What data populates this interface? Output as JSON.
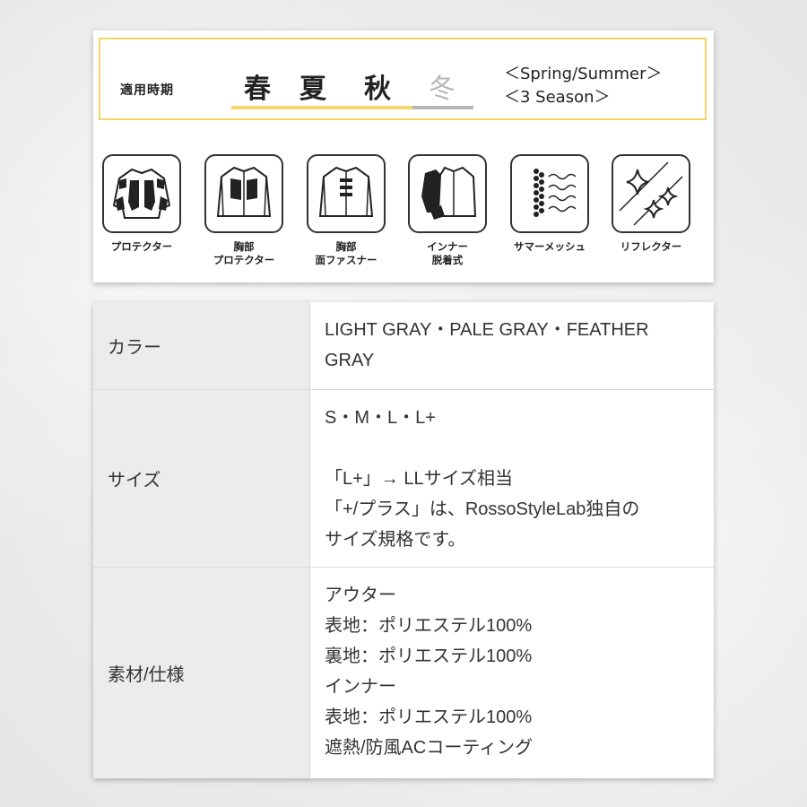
{
  "season": {
    "label": "適用時期",
    "words": [
      "春",
      "夏",
      "秋",
      "冬"
    ],
    "active": [
      true,
      true,
      true,
      false
    ],
    "english_line1": "＜Spring/Summer＞",
    "english_line2": "＜3 Season＞",
    "colors": {
      "active_bar": "#f3d56a",
      "inactive_bar": "#b8b8b8",
      "border": "#f3d56a"
    }
  },
  "features": [
    {
      "icon": "jacket-protector-icon",
      "label_line1": "プロテクター",
      "label_line2": ""
    },
    {
      "icon": "chest-protector-icon",
      "label_line1": "胸部",
      "label_line2": "プロテクター"
    },
    {
      "icon": "chest-fastener-icon",
      "label_line1": "胸部",
      "label_line2": "面ファスナー"
    },
    {
      "icon": "removable-inner-icon",
      "label_line1": "インナー",
      "label_line2": "脱着式"
    },
    {
      "icon": "summer-mesh-icon",
      "label_line1": "サマーメッシュ",
      "label_line2": ""
    },
    {
      "icon": "reflector-icon",
      "label_line1": "リフレクター",
      "label_line2": ""
    }
  ],
  "specs": {
    "accent_color": "#e21a1a",
    "rows": [
      {
        "label": "カラー",
        "lines": [
          "LIGHT GRAY・PALE GRAY・FEATHER GRAY"
        ]
      },
      {
        "label": "サイズ",
        "lines": [
          "S・M・L・L+",
          "",
          "「L+」→ LLサイズ相当",
          "「+/プラス」は、RossoStyleLab独自の",
          "サイズ規格です。"
        ]
      },
      {
        "label": "素材/仕様",
        "lines": [
          "アウター",
          "表地：ポリエステル100%",
          "裏地：ポリエステル100%",
          "インナー",
          "表地：ポリエステル100%",
          "遮熱/防風ACコーティング"
        ]
      }
    ]
  }
}
